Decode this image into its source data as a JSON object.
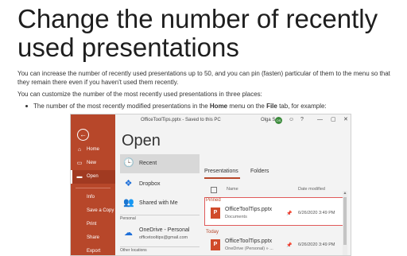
{
  "article": {
    "title": "Change the number of recently used presentations",
    "para1": "You can increase the number of recently used presentations up to 50, and you can pin (fasten) particular of them to the menu so that they remain there even if you haven't used them recently.",
    "para2": "You can customize the number of the most recently used presentations in three places:",
    "bullet": {
      "prefix": "The number of the most recently modified presentations in the ",
      "home": "Home",
      "middle": " menu on the ",
      "file": "File",
      "suffix": " tab, for example:"
    }
  },
  "window": {
    "doc_title": "OfficeToolTips.pptx  -  Saved to this PC",
    "user_name": "Olga S",
    "avatar_initials": "OS",
    "smiley": "☺",
    "help": "?",
    "minimize": "—",
    "maximize": "▢",
    "close": "✕",
    "heading": "Open",
    "accent_color": "#b7472a",
    "rail": {
      "back": "←",
      "items": [
        {
          "label": "Home",
          "icon": "⌂"
        },
        {
          "label": "New",
          "icon": "▭"
        },
        {
          "label": "Open",
          "icon": "▬"
        },
        {
          "label": "Info",
          "icon": ""
        },
        {
          "label": "Save a Copy",
          "icon": ""
        },
        {
          "label": "Print",
          "icon": ""
        },
        {
          "label": "Share",
          "icon": ""
        },
        {
          "label": "Export",
          "icon": ""
        }
      ]
    },
    "places": {
      "recent": "Recent",
      "dropbox": "Dropbox",
      "shared": "Shared with Me",
      "personal_section": "Personal",
      "onedrive_title": "OneDrive - Personal",
      "onedrive_email": "officetooltips@gmail.com",
      "other_section": "Other locations"
    },
    "files": {
      "tab_presentations": "Presentations",
      "tab_folders": "Folders",
      "col_name": "Name",
      "col_date": "Date modified",
      "pinned_label": "Pinned",
      "today_label": "Today",
      "pinned_file": {
        "name": "OfficeToolTips.pptx",
        "location": "Documents",
        "date": "6/26/2020 3:49 PM",
        "pin": "📌"
      },
      "today_file": {
        "name": "OfficeToolTips.pptx",
        "location": "OneDrive (Personal) » ...",
        "date": "6/26/2020 3:49 PM",
        "pin": "📌"
      }
    }
  }
}
